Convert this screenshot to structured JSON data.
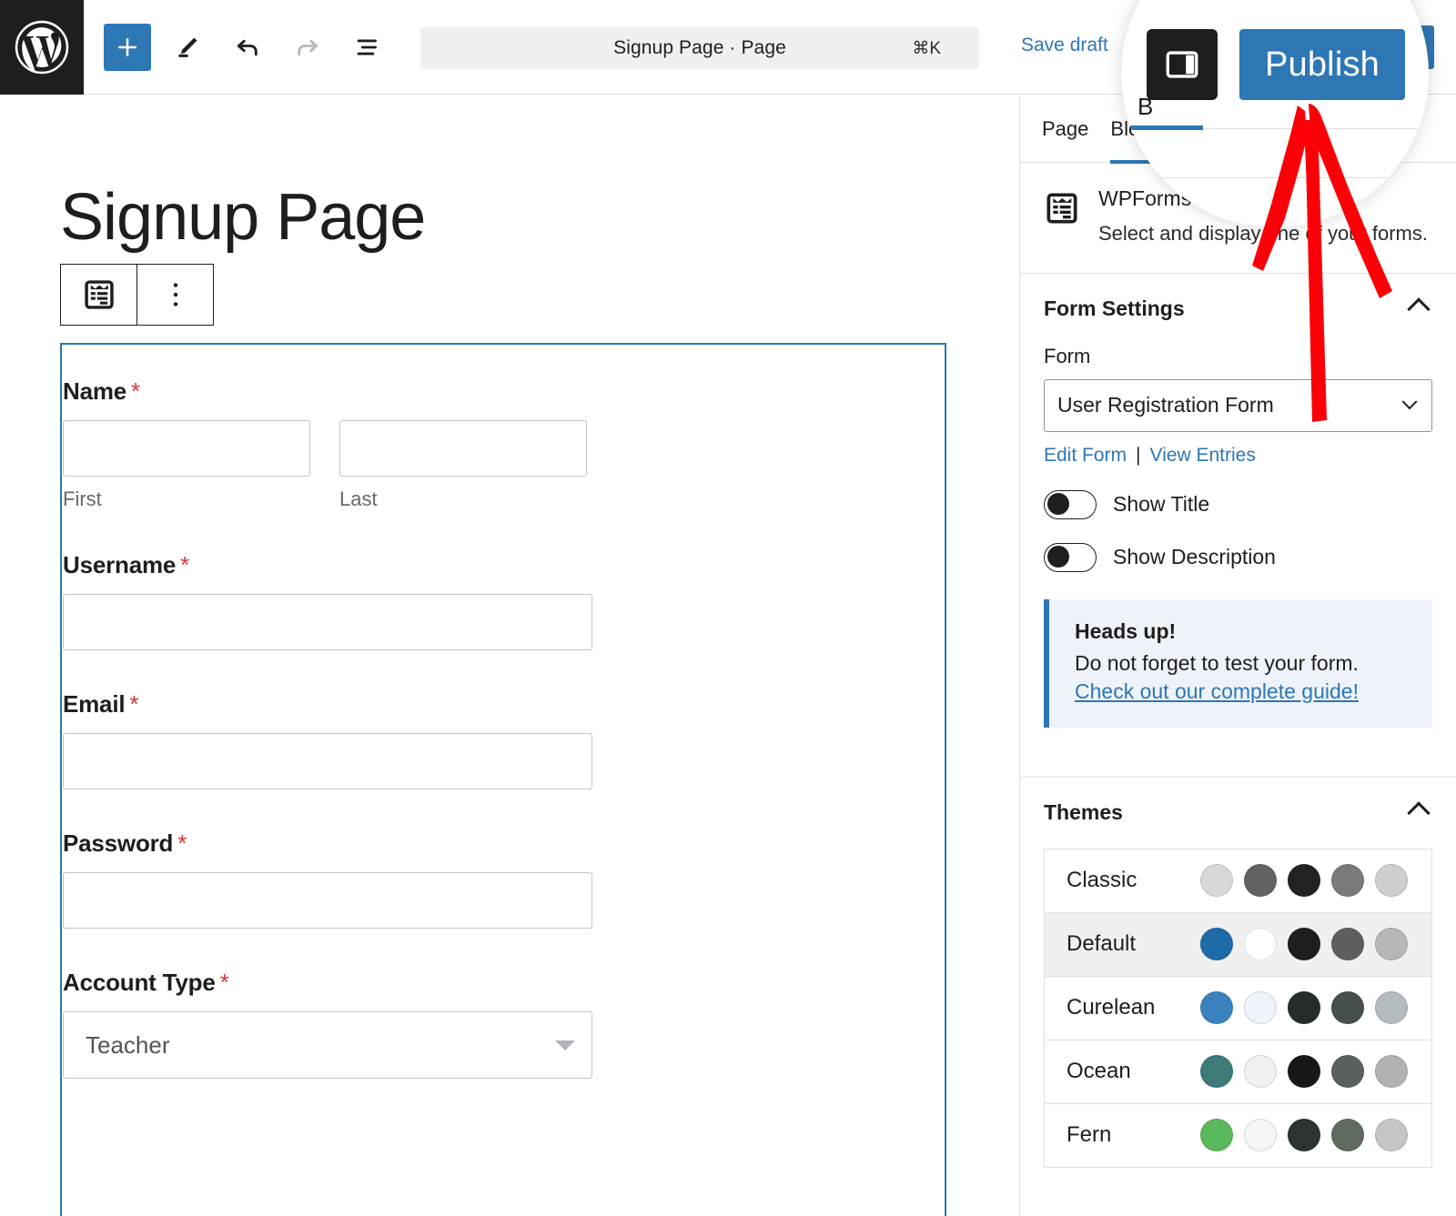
{
  "topbar": {
    "logo_icon": "wordpress-logo-icon",
    "add_block_label": "+",
    "add_block_icon": "plus-icon",
    "tools_icon": "pencil-tools-icon",
    "undo_icon": "undo-arrow-icon",
    "redo_icon": "redo-arrow-icon",
    "list_view_icon": "list-view-icon",
    "document_title": "Signup Page · Page",
    "command_shortcut": "⌘K",
    "save_draft_label": "Save draft",
    "sidebar_toggle_icon": "sidebar-panel-icon",
    "publish_label": "Publish"
  },
  "magnifier": {
    "sidebar_toggle_icon": "sidebar-panel-icon",
    "publish_label": "Publish",
    "tab_fragment": "B"
  },
  "canvas": {
    "page_title": "Signup Page",
    "block_toolbar": {
      "block_icon": "wpforms-block-icon",
      "options_icon": "more-options-vertical-dots-icon"
    },
    "form": {
      "required_marker": "*",
      "fields": [
        {
          "label": "Name",
          "required": true,
          "type": "name",
          "sublabels": [
            "First",
            "Last"
          ],
          "values": [
            "",
            ""
          ]
        },
        {
          "label": "Username",
          "required": true,
          "type": "text",
          "value": ""
        },
        {
          "label": "Email",
          "required": true,
          "type": "email",
          "value": ""
        },
        {
          "label": "Password",
          "required": true,
          "type": "password",
          "value": ""
        },
        {
          "label": "Account Type",
          "required": true,
          "type": "select",
          "value": "Teacher"
        }
      ]
    }
  },
  "sidebar": {
    "tabs": [
      {
        "label": "Page",
        "active": false
      },
      {
        "label": "Block",
        "active": true
      }
    ],
    "block_card": {
      "icon": "wpforms-block-icon",
      "title": "WPForms",
      "description": "Select and display one of your forms."
    },
    "form_settings": {
      "panel_title": "Form Settings",
      "collapse_icon": "chevron-up-icon",
      "form_field_label": "Form",
      "selected_form": "User Registration Form",
      "select_icon": "chevron-down-icon",
      "edit_form_label": "Edit Form",
      "link_divider": "|",
      "view_entries_label": "View Entries",
      "toggles": [
        {
          "label": "Show Title",
          "on": false
        },
        {
          "label": "Show Description",
          "on": false
        }
      ],
      "notice": {
        "title": "Heads up!",
        "text": "Do not forget to test your form.",
        "link": "Check out our complete guide!",
        "accent": "#2e77b5"
      }
    },
    "themes": {
      "panel_title": "Themes",
      "collapse_icon": "chevron-up-icon",
      "items": [
        {
          "name": "Classic",
          "selected": false,
          "colors": [
            "#d8d8d8",
            "#626262",
            "#222222",
            "#7a7a7a",
            "#cfcfcf"
          ]
        },
        {
          "name": "Default",
          "selected": true,
          "colors": [
            "#1d6ca8",
            "#ffffff",
            "#1e1e1e",
            "#5c5f62",
            "#b5b7b9"
          ]
        },
        {
          "name": "Curelean",
          "selected": false,
          "colors": [
            "#3a82bd",
            "#eef4fa",
            "#262b2b",
            "#454f4f",
            "#b4bcc0"
          ]
        },
        {
          "name": "Ocean",
          "selected": false,
          "colors": [
            "#3d7b7b",
            "#eef2f2",
            "#171717",
            "#5a5f5f",
            "#b0b3b3"
          ]
        },
        {
          "name": "Fern",
          "selected": false,
          "colors": [
            "#5cb85c",
            "#f3f6f3",
            "#2d332d",
            "#5f6b5f",
            "#c2c7c2"
          ]
        }
      ]
    }
  },
  "annotation": {
    "arrow_color": "#fb0007",
    "arrow_icon": "red-arrow-pointing-up-icon",
    "points_to": "publish-button"
  }
}
